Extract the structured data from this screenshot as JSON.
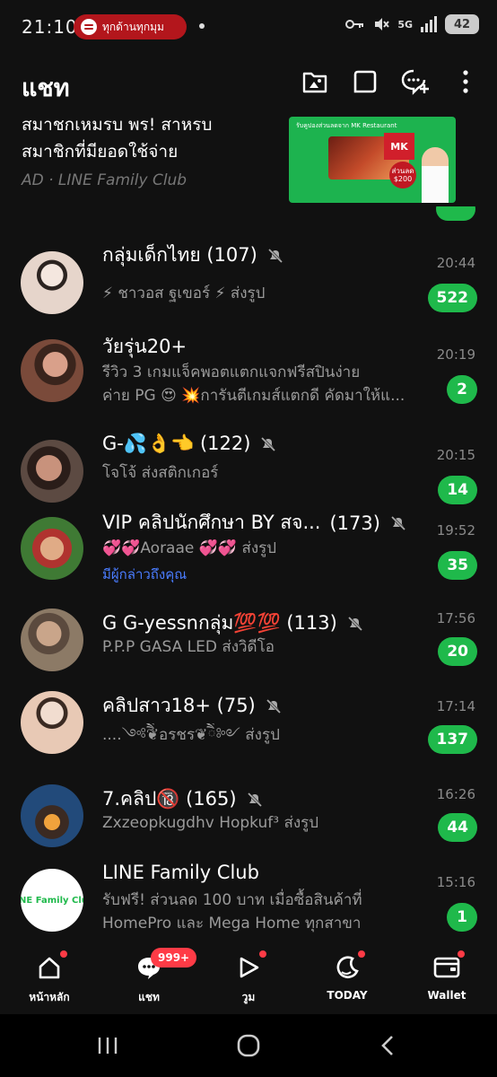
{
  "status_bar": {
    "time": "21:10",
    "spotify_label": "ทุกด้านทุกมุม",
    "network": "5G",
    "battery": "42"
  },
  "header": {
    "title": "แชท",
    "icons": [
      "gallery-folder-icon",
      "square-note-icon",
      "chat-add-icon",
      "more-vertical-icon"
    ]
  },
  "ad": {
    "line1": "สมาชกเหมรบ พร! สาหรบ",
    "line2": "สมาชิกที่มียอดใช้จ่าย",
    "source": "AD · LINE Family Club",
    "banner_top": "รับคูปองส่วนลดจาก MK Restaurant",
    "banner_brand": "MK",
    "banner_discount": "ส่วนลด $200"
  },
  "chats": [
    {
      "name": "กลุ่มเด็กไทย (107)",
      "muted": true,
      "preview": "⚡ ชาวอส ฐเขอร์ ⚡ ส่งรูป",
      "time": "20:44",
      "badge": "522",
      "avatar_colors": [
        "#d8c7bd",
        "#f5ece7"
      ]
    },
    {
      "name": "วัยรุ่น20+",
      "muted": false,
      "preview": "รีวิว 3 เกมแจ็คพอตแตกแจกฟรีสปินง่าย",
      "preview2": "ค่าย PG 😍 💥การันตีเกมส์แตกดี คัดมาให้แ...",
      "time": "20:19",
      "badge": "2",
      "avatar_colors": [
        "#6a3b2c",
        "#c9816b"
      ]
    },
    {
      "name": "G-💦👌👈 (122)",
      "muted": true,
      "preview": "โจโจ้ ส่งสติกเกอร์",
      "time": "20:15",
      "badge": "14",
      "avatar_colors": [
        "#3a2a25",
        "#b88a78"
      ]
    },
    {
      "name": "VIP คลิปนักศึกษา BY สจ...",
      "name_count": "(173)",
      "muted": true,
      "preview": "💞💞Aoraae 💞💞 ส่งรูป",
      "mention": "มีผู้กล่าวถึงคุณ",
      "time": "19:52",
      "badge": "35",
      "avatar_colors": [
        "#2e6b2a",
        "#d9a07c"
      ]
    },
    {
      "name": "G G-yessnกลุ่ม💯💯 (113)",
      "muted": true,
      "preview": "P.P.P  GASA  LED ส่งวิดีโอ",
      "time": "17:56",
      "badge": "20",
      "avatar_colors": [
        "#7c6b59",
        "#c9b39a"
      ]
    },
    {
      "name": "คลิปสาว18+ (75)",
      "muted": true,
      "preview": "....༺ཻིཻ❦อรชร❦ཻིཻ༻ ส่งรูป",
      "time": "17:14",
      "badge": "137",
      "avatar_colors": [
        "#e9d7cc",
        "#caa890"
      ]
    },
    {
      "name": "7.คลิป🔞 (165)",
      "muted": true,
      "preview": "Zxzeopkugdhv Hopkuf³ ส่งรูป",
      "time": "16:26",
      "badge": "44",
      "avatar_colors": [
        "#1c3e66",
        "#c98433"
      ]
    },
    {
      "name": "LINE Family Club",
      "muted": false,
      "preview": "รับฟรี! ส่วนลด 100 บาท เมื่อซื้อสินค้าที่",
      "preview2": "HomePro และ Mega Home ทุกสาขา",
      "time": "15:16",
      "badge": "1",
      "avatar_logo": "LINE Family Club"
    }
  ],
  "bottom_nav": [
    {
      "label": "หน้าหลัก",
      "icon": "home-icon",
      "dot": true
    },
    {
      "label": "แชท",
      "icon": "chat-icon",
      "count": "999+"
    },
    {
      "label": "วูม",
      "icon": "voom-play-icon",
      "dot": true
    },
    {
      "label": "TODAY",
      "icon": "today-moon-icon",
      "dot": true
    },
    {
      "label": "Wallet",
      "icon": "wallet-icon",
      "dot": true
    }
  ],
  "colors": {
    "background": "#111111",
    "badge_green": "#1fb94b",
    "notification_red": "#ff3b46",
    "mention_blue": "#4a7cff"
  }
}
